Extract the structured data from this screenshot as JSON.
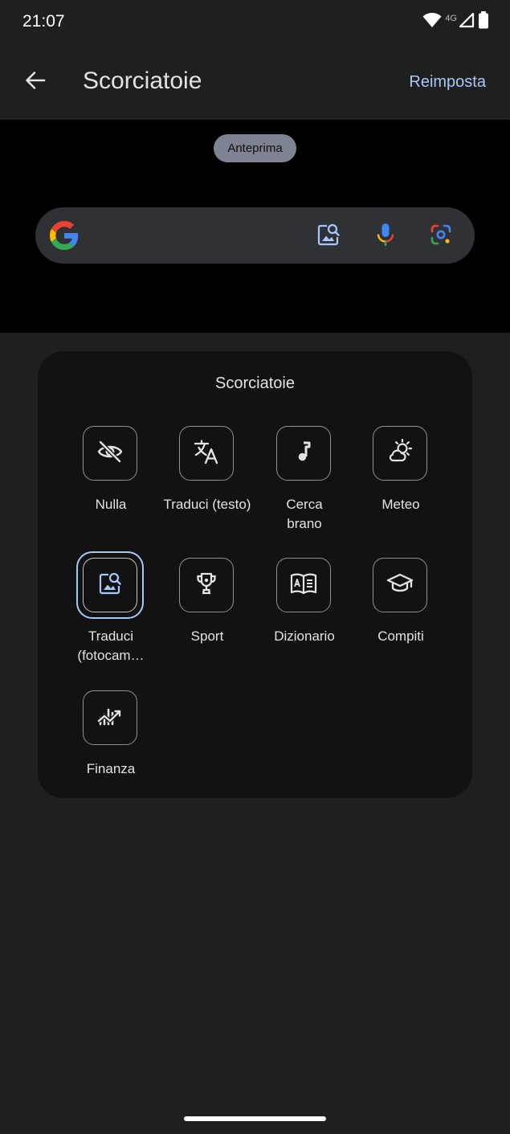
{
  "status_bar": {
    "time": "21:07",
    "network": "4G",
    "icons": [
      "wifi-icon",
      "signal-icon",
      "battery-icon"
    ]
  },
  "app_bar": {
    "title": "Scorciatoie",
    "reset_label": "Reimposta",
    "back_icon": "arrow-back-icon"
  },
  "preview": {
    "chip_label": "Anteprima",
    "search_icons": [
      "google-logo",
      "image-search-icon",
      "mic-icon",
      "lens-icon"
    ]
  },
  "shortcuts_panel": {
    "title": "Scorciatoie",
    "items": [
      {
        "label": "Nulla",
        "icon": "eye-off-icon",
        "selected": false
      },
      {
        "label": "Traduci (testo)",
        "icon": "translate-icon",
        "selected": false
      },
      {
        "label": "Cerca brano",
        "icon": "music-note-icon",
        "selected": false
      },
      {
        "label": "Meteo",
        "icon": "weather-icon",
        "selected": false
      },
      {
        "label": "Traduci (fotocam…",
        "icon": "image-search-icon",
        "selected": true
      },
      {
        "label": "Sport",
        "icon": "trophy-icon",
        "selected": false
      },
      {
        "label": "Dizionario",
        "icon": "dictionary-icon",
        "selected": false
      },
      {
        "label": "Compiti",
        "icon": "school-icon",
        "selected": false
      },
      {
        "label": "Finanza",
        "icon": "finance-icon",
        "selected": false
      }
    ]
  },
  "colors": {
    "background": "#1f1f1f",
    "preview_background": "#000000",
    "panel_background": "#121212",
    "accent": "#a8c7fa",
    "chip": "#7d8392"
  }
}
